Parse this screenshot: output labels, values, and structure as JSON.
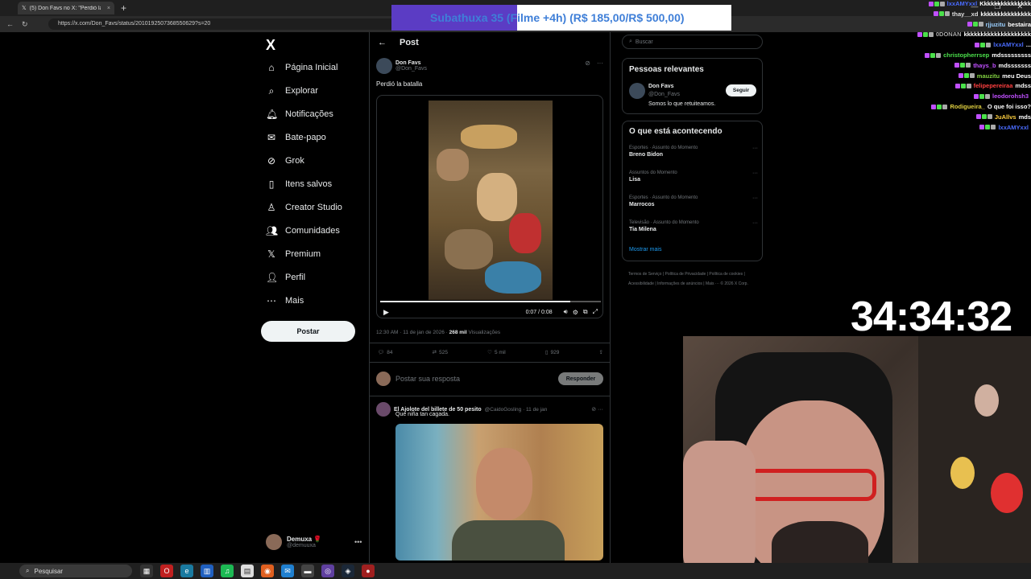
{
  "browser": {
    "tab_title": "(5) Don Favs no X: \"Perdió la batalla\"",
    "url": "https://x.com/Don_Favs/status/2010192507368550629?s=20"
  },
  "banner": {
    "text": "Subathuxa 35 (Filme +4h) (R$ 185,00/R$ 500,00)",
    "progress_fraction": 0.37,
    "fill_color": "#5b3cc4"
  },
  "nav": {
    "logo": "X",
    "items": [
      {
        "label": "Página Inicial",
        "icon": "home-icon"
      },
      {
        "label": "Explorar",
        "icon": "search-icon"
      },
      {
        "label": "Notificações",
        "icon": "bell-icon"
      },
      {
        "label": "Bate-papo",
        "icon": "mail-icon"
      },
      {
        "label": "Grok",
        "icon": "grok-icon"
      },
      {
        "label": "Itens salvos",
        "icon": "bookmark-icon"
      },
      {
        "label": "Creator Studio",
        "icon": "creator-icon"
      },
      {
        "label": "Comunidades",
        "icon": "people-icon"
      },
      {
        "label": "Premium",
        "icon": "x-icon"
      },
      {
        "label": "Perfil",
        "icon": "person-icon"
      },
      {
        "label": "Mais",
        "icon": "more-circle-icon"
      }
    ],
    "post_button": "Postar",
    "user": {
      "name": "Demuxa 🌹",
      "handle": "@demuuxa"
    }
  },
  "main": {
    "header_title": "Post",
    "post": {
      "author_name": "Don Favs",
      "author_handle": "@Don_Favs",
      "text": "Perdió la batalla",
      "video_time": "0:07 / 0:08",
      "video_progress": 0.86,
      "timestamp": "12:30 AM · 11 de jan de 2026 · ",
      "views": "268 mil",
      "views_label": " Visualizações",
      "stats": {
        "replies": "84",
        "reposts": "525",
        "likes": "5 mil",
        "bookmarks": "929"
      }
    },
    "reply_placeholder": "Postar sua resposta",
    "reply_button": "Responder",
    "reply": {
      "name": "El Ajolote del billete de 50 pesito",
      "handle": "@CaidoGosling · 11 de jan",
      "text": "Que niña tan cagada."
    }
  },
  "right": {
    "search_placeholder": "Buscar",
    "relevant_title": "Pessoas relevantes",
    "relevant": {
      "name": "Don Favs",
      "handle": "@Don_Favs",
      "bio": "Somos lo que retuiteamos.",
      "follow": "Seguir"
    },
    "trending_title": "O que está acontecendo",
    "trends": [
      {
        "category": "Esportes · Assunto do Momento",
        "name": "Breno Bidon"
      },
      {
        "category": "Assuntos do Momento",
        "name": "Lisa"
      },
      {
        "category": "Esportes · Assunto do Momento",
        "name": "Marrocos"
      },
      {
        "category": "Televisão · Assunto do Momento",
        "name": "Tia Milena"
      }
    ],
    "show_more": "Mostrar mais",
    "footer": "Termos de Serviço | Política de Privacidade | Política de cookies | Acessibilidade | Informações de anúncios | Mais ··· © 2026 X Corp."
  },
  "chat": [
    {
      "user": "lxxAMYxxl",
      "color": "#4a6cff",
      "msg": "Kkkkkkkkkkkkkkk"
    },
    {
      "user": "thay__xd",
      "color": "#e0e0e0",
      "msg": "kkkkkkkkkkkkkkk"
    },
    {
      "user": "rjjuzitu",
      "color": "#9ad0ff",
      "msg": "bestaira"
    },
    {
      "user": "0DONAN",
      "color": "#aaaaaa",
      "msg": "kkkkkkkkkkkkkkkkkkkk"
    },
    {
      "user": "lxxAMYxxl",
      "color": "#4a6cff",
      "msg": "..."
    },
    {
      "user": "christopherrsep",
      "color": "#4be04b",
      "msg": "mdsssssssss"
    },
    {
      "user": "thays_b",
      "color": "#c050ff",
      "msg": "mdsssssss"
    },
    {
      "user": "mauzitu",
      "color": "#80d040",
      "msg": "meu Deus"
    },
    {
      "user": "felipepereiraa",
      "color": "#ff4040",
      "msg": "mdss"
    },
    {
      "user": "leodorohsh3",
      "color": "#c050ff",
      "msg": ""
    },
    {
      "user": "Rodigueira_",
      "color": "#e0d040",
      "msg": "O que foi isso?"
    },
    {
      "user": "JuAllvs",
      "color": "#ffd040",
      "msg": "mds"
    },
    {
      "user": "lxxAMYxxl",
      "color": "#4a6cff",
      "msg": ""
    }
  ],
  "timer": "34:34:32",
  "taskbar": {
    "search_placeholder": "Pesquisar"
  }
}
